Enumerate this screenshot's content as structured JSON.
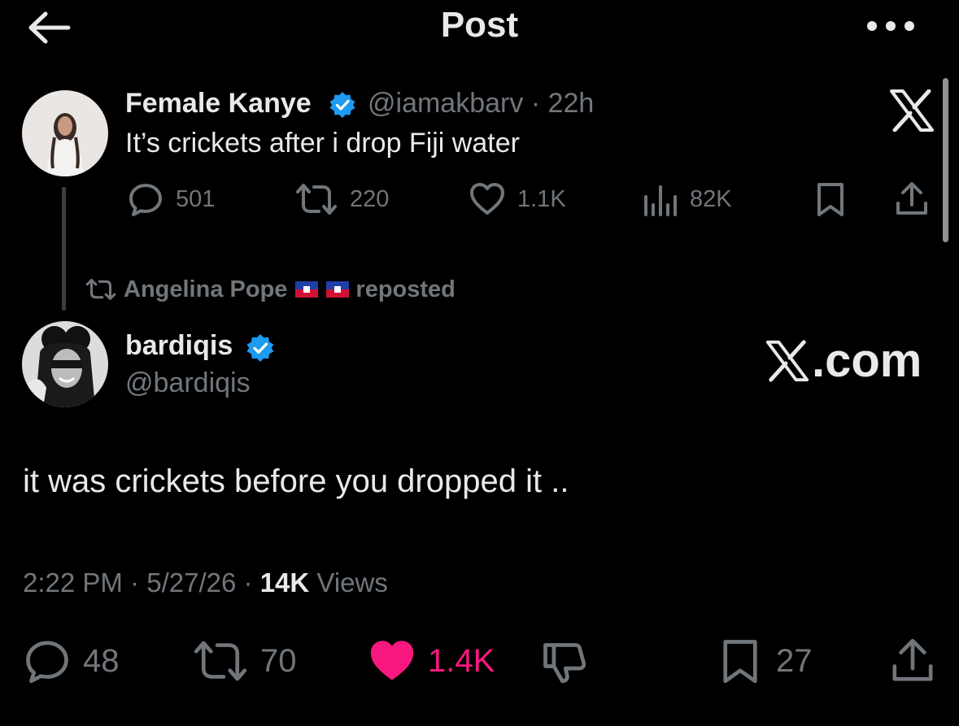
{
  "header": {
    "title": "Post",
    "back_icon": "arrow-left-icon",
    "more_icon": "more-horizontal-icon"
  },
  "parent_post": {
    "display_name": "Female Kanye",
    "handle": "@iamakbarv",
    "separator": "·",
    "time": "22h",
    "text": "It’s crickets after i drop Fiji water",
    "verified_color": "#1d9bf0",
    "actions": {
      "replies": "501",
      "reposts": "220",
      "likes": "1.1K",
      "views": "82K"
    }
  },
  "repost_notice": {
    "name": "Angelina Pope",
    "label": "reposted"
  },
  "main_post": {
    "display_name": "bardiqis",
    "handle": "@bardiqis",
    "watermark": ".com",
    "text": "it was crickets before you dropped it ..",
    "time": "2:22 PM",
    "separator": "·",
    "date": "5/27/26",
    "views_count": "14K",
    "views_label": "Views",
    "actions": {
      "replies": "48",
      "reposts": "70",
      "likes": "1.4K",
      "bookmarks": "27"
    },
    "like_color": "#f91880"
  }
}
